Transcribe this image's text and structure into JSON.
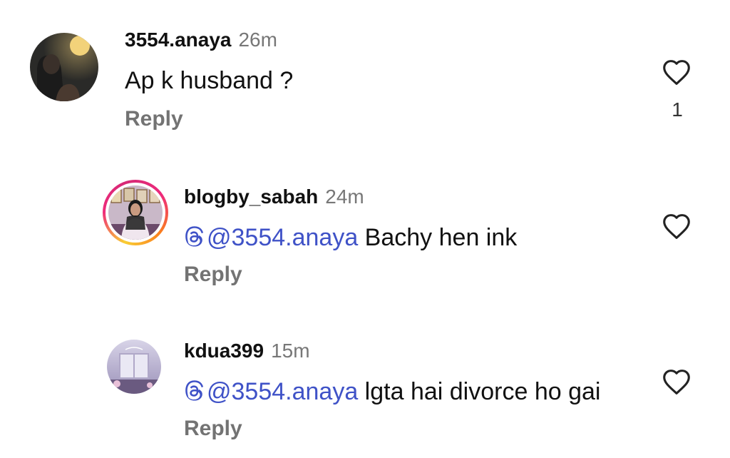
{
  "comments": [
    {
      "username": "3554.anaya",
      "time": "26m",
      "text": "Ap k husband ?",
      "reply_label": "Reply",
      "like_count": "1",
      "avatar_icon": "profile-photo-moon"
    },
    {
      "username": "blogby_sabah",
      "time": "24m",
      "mention": "@3554.anaya",
      "text": " Bachy hen ink",
      "reply_label": "Reply",
      "avatar_icon": "profile-photo-with-story-ring"
    },
    {
      "username": "kdua399",
      "time": "15m",
      "mention": "@3554.anaya",
      "text": " lgta hai divorce ho gai",
      "reply_label": "Reply",
      "avatar_icon": "profile-photo-window"
    }
  ],
  "colors": {
    "mention": "#3f52c7",
    "secondary_text": "#737373",
    "story_ring": [
      "#f9ce34",
      "#ee2a7b",
      "#6228d7"
    ]
  }
}
